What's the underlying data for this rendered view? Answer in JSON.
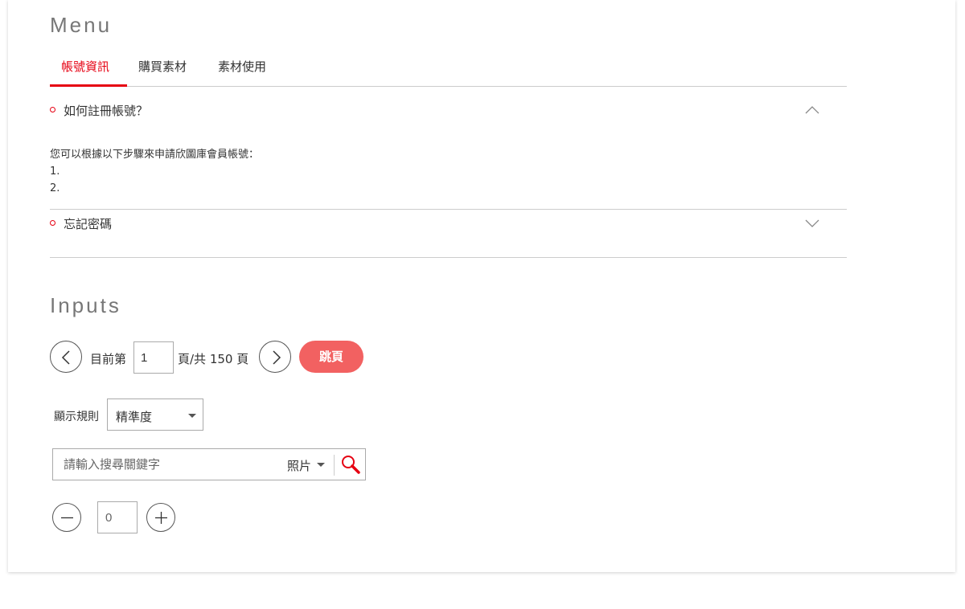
{
  "menu": {
    "title": "Menu",
    "tabs": [
      {
        "label": "帳號資訊",
        "active": true
      },
      {
        "label": "購買素材",
        "active": false
      },
      {
        "label": "素材使用",
        "active": false
      }
    ],
    "accordion": [
      {
        "question": "如何註冊帳號？",
        "expanded": true,
        "answer": [
          "您可以根據以下步驟來申請欣圖庫會員帳號：",
          "1.",
          "2."
        ]
      },
      {
        "question": "忘記密碼",
        "expanded": false
      }
    ]
  },
  "inputs": {
    "title": "Inputs",
    "pagination": {
      "prefix": "目前第",
      "current_page": "1",
      "suffix": "頁/共 150 頁",
      "jump_label": "跳頁"
    },
    "sort": {
      "label": "顯示規則",
      "selected": "精準度"
    },
    "search": {
      "placeholder": "請輸入搜尋關鍵字",
      "type_selected": "照片"
    },
    "stepper": {
      "value": "0"
    }
  },
  "colors": {
    "accent": "#e60012",
    "button": "#f26161",
    "border": "#cccccc"
  }
}
